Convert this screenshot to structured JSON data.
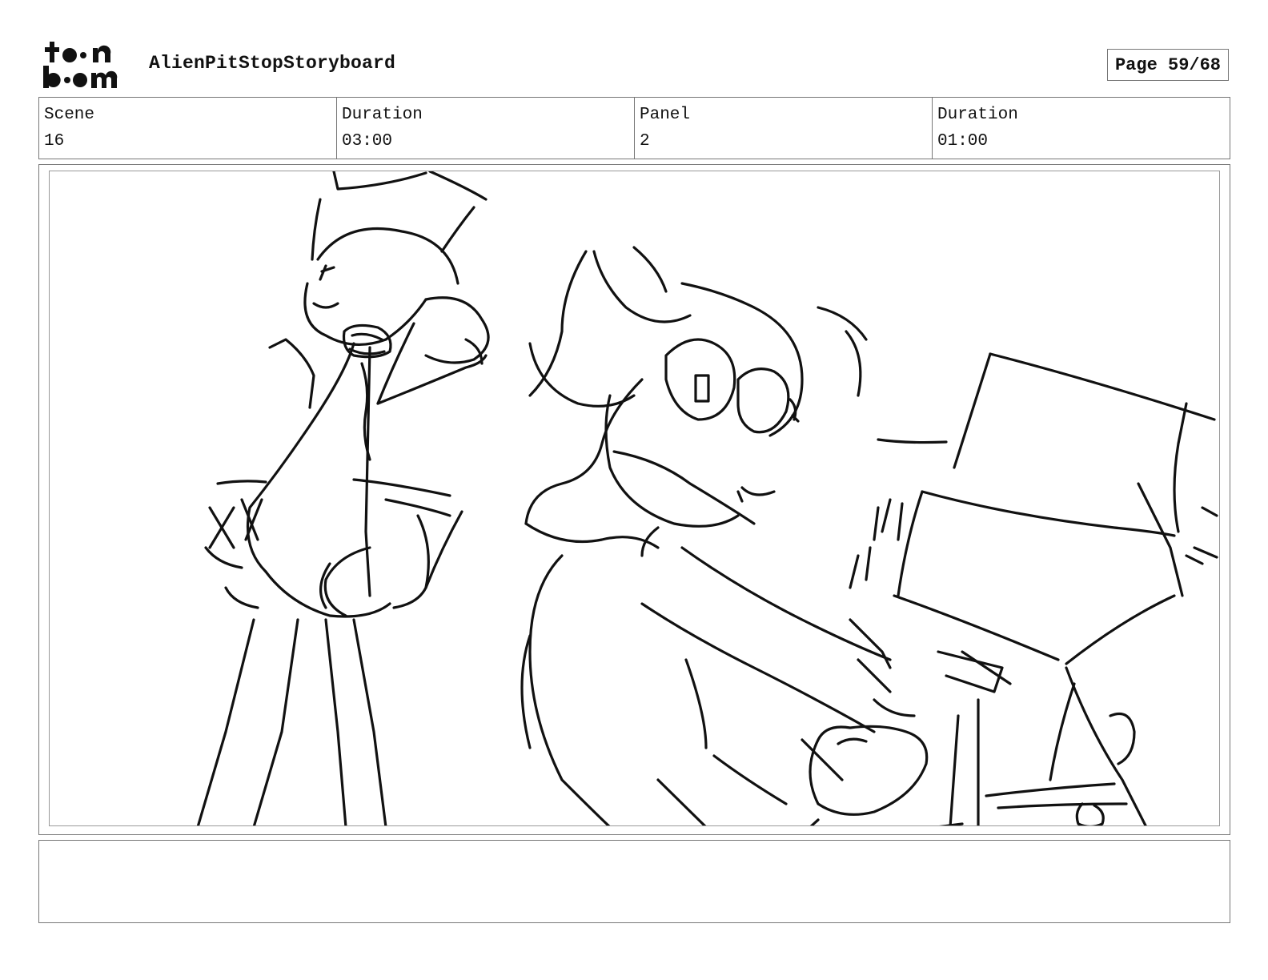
{
  "header": {
    "logo_text": "toon boom",
    "project_title": "AlienPitStopStoryboard",
    "page_label": "Page 59/68"
  },
  "info": {
    "scene_label": "Scene",
    "scene_value": "16",
    "scene_duration_label": "Duration",
    "scene_duration_value": "03:00",
    "panel_label": "Panel",
    "panel_value": "2",
    "panel_duration_label": "Duration",
    "panel_duration_value": "01:00"
  },
  "panel": {
    "image_description_icon": "storyboard-sketch"
  },
  "notes": {
    "text": ""
  }
}
